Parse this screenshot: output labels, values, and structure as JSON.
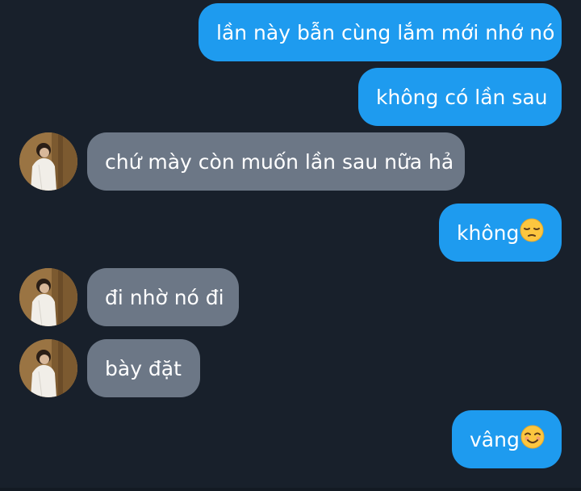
{
  "chat": {
    "messages": [
      {
        "direction": "out",
        "text": "lần này bẫn cùng lắm mới nhớ nó"
      },
      {
        "direction": "out",
        "text": "không có lần sau"
      },
      {
        "direction": "in",
        "text": "chứ mày còn muốn lần sau nữa hả",
        "avatar": true
      },
      {
        "direction": "out",
        "text": "không",
        "emoji": "pensive-face-emoji"
      },
      {
        "direction": "in",
        "text": "đi nhờ nó đi",
        "avatar": true
      },
      {
        "direction": "in",
        "text": "bày đặt",
        "avatar": true
      },
      {
        "direction": "out",
        "text": "vâng",
        "emoji": "smiling-face-emoji"
      }
    ]
  },
  "colors": {
    "background": "#18202b",
    "outgoing_bubble": "#1e9bef",
    "incoming_bubble": "#6c7786",
    "text": "#ffffff"
  }
}
